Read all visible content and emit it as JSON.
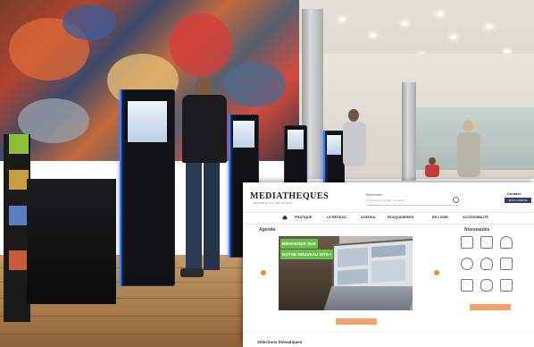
{
  "site": {
    "logo": "MEDIATHEQUES",
    "logo_sub": "ROUBAIX AU CŒUR MAG",
    "search_label": "Rechercher",
    "search_placeholder": "un document, un titre, un auteur ...",
    "contact": "Contact",
    "account_button": "MON COMPTE",
    "nav": [
      "PRATIQUE",
      "LE RESEAU",
      "AGENDA",
      "BOUQUINERIES",
      "EN LIGNE",
      "ACCESSIBILITÉ"
    ],
    "agenda_title": "Agenda",
    "news_title": "Nouveautés",
    "banner_line1": "BIENVENUE SUR",
    "banner_line2": "NOTRE NOUVEAU SITE !",
    "bottom_title": "Sélections thématiques"
  },
  "colors": {
    "accent_green": "#6cc04a",
    "accent_orange": "#f08a2a",
    "kiosk_glow": "#3a7bff",
    "account_blue": "#2f3d6b"
  },
  "icons": [
    "cube-icon",
    "clapper-icon",
    "headphones-icon",
    "speech-icon",
    "lightbulb-icon",
    "person-icon",
    "book-icon",
    "tablet-icon",
    "ebook-icon"
  ]
}
